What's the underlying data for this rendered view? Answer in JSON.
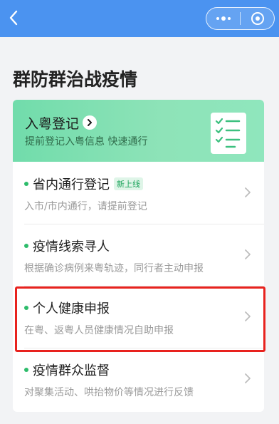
{
  "page": {
    "title": "群防群治战疫情"
  },
  "banner": {
    "title": "入粤登记",
    "subtitle": "提前登记入粤信息 快速通行"
  },
  "items": [
    {
      "title": "省内通行登记",
      "badge": "新上线",
      "desc": "入市/市内通行，请提前登记"
    },
    {
      "title": "疫情线索寻人",
      "desc": "根据确诊病例来粤轨迹，同行者主动申报"
    },
    {
      "title": "个人健康申报",
      "desc": "在粤、返粤人员健康情况自助申报"
    },
    {
      "title": "疫情群众监督",
      "desc": "对聚集活动、哄抬物价等情况进行反馈"
    }
  ],
  "colors": {
    "nav": "#4b93f0",
    "banner": "#71dcab",
    "dot": "#2dbc6b",
    "highlight": "#e8221e"
  }
}
